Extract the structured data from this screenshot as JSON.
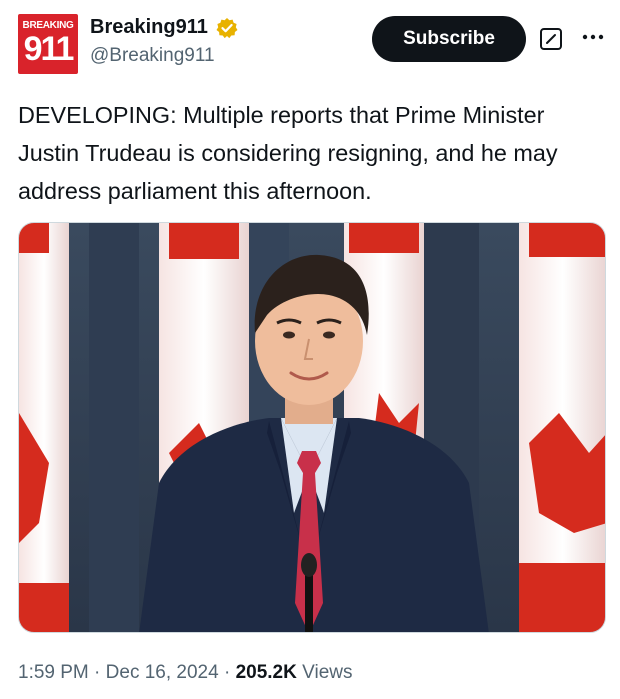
{
  "account": {
    "avatar_top_text": "BREAKING",
    "avatar_number": "911",
    "display_name": "Breaking911",
    "handle": "@Breaking911",
    "verified_color": "#e8b200"
  },
  "actions": {
    "subscribe_label": "Subscribe",
    "more_icon": "more-horizontal-icon",
    "grok_icon": "grok-icon"
  },
  "tweet": {
    "text": "DEVELOPING: Multiple reports that Prime Minister Justin Trudeau is considering resigning, and he may address parliament this afternoon."
  },
  "meta": {
    "time": "1:59 PM",
    "date": "Dec 16, 2024",
    "views_count": "205.2K",
    "views_label": "Views",
    "separator": "·"
  },
  "colors": {
    "avatar_bg": "#d9232b",
    "subscribe_bg": "#0f1419",
    "text_primary": "#0f1419",
    "text_secondary": "#536471"
  }
}
